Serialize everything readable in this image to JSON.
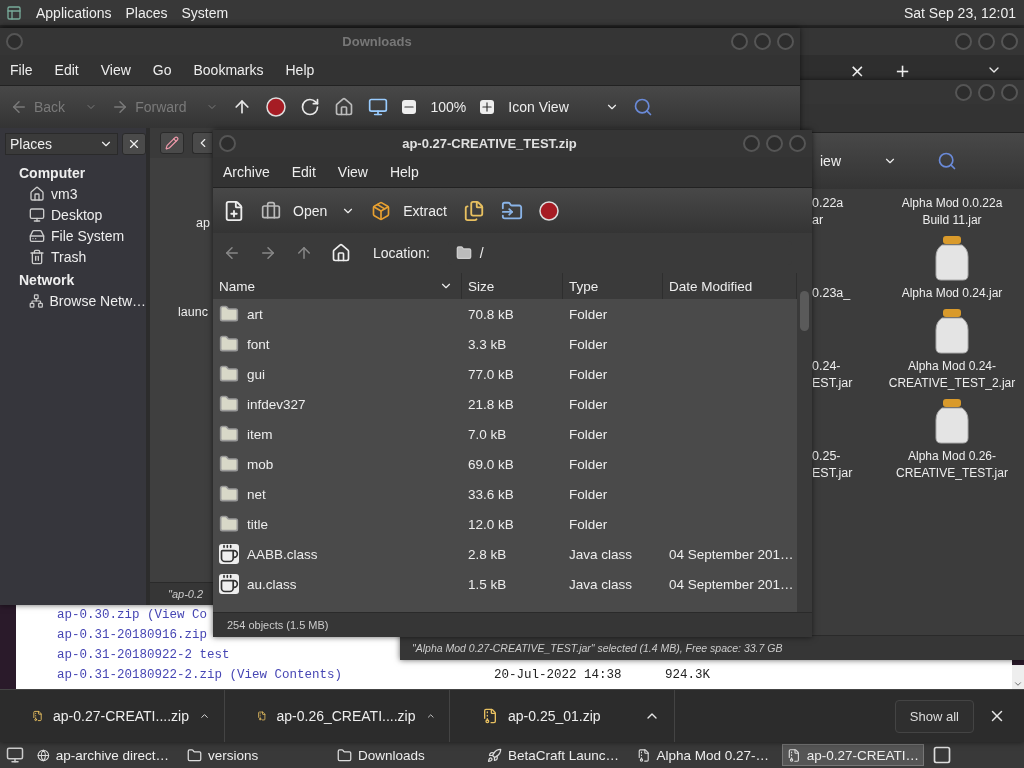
{
  "top_panel": {
    "menus": [
      "Applications",
      "Places",
      "System"
    ],
    "clock": "Sat Sep 23, 12:01"
  },
  "browser": {
    "tab_strip": {
      "close": "×",
      "new_tab": "+"
    },
    "listing": [
      {
        "name": "ap-0.30.zip",
        "detail": "(View Co"
      },
      {
        "name": "ap-0.31-20180916.zip"
      },
      {
        "name": "ap-0.31-20180922-2 test"
      },
      {
        "name": "ap-0.31-20180922-2.zip",
        "detail": "(View Contents)",
        "date": "20-Jul-2022 14:38",
        "size": "924.3K"
      }
    ],
    "downloads": [
      {
        "file": "ap-0.27-CREATI....zip"
      },
      {
        "file": "ap-0.26_CREATI....zip"
      },
      {
        "file": "ap-0.25_01.zip"
      }
    ],
    "show_all": "Show all"
  },
  "back_window": {
    "view_mode": "iew",
    "icons": [
      {
        "kind": "label",
        "label": "Alpha Mod 0.0.22a Build 11.jar",
        "cut_label": [
          "0.22a",
          "ar"
        ]
      },
      {
        "kind": "jar",
        "label": "Alpha Mod 0.24.jar",
        "cut_label": [
          "0.23a_"
        ]
      },
      {
        "kind": "jar",
        "label": "Alpha Mod 0.24-CREATIVE_TEST_2.jar",
        "cut_label": [
          "0.24-",
          "EST.jar"
        ]
      },
      {
        "kind": "jar",
        "label": "Alpha Mod 0.26-CREATIVE_TEST.jar",
        "cut_label": [
          "0.25-",
          "EST.jar"
        ]
      }
    ],
    "status": "\"Alpha Mod 0.27-CREATIVE_TEST.jar\" selected (1.4 MB), Free space: 33.7 GB"
  },
  "downloads_window": {
    "title": "Downloads",
    "menus": [
      "File",
      "Edit",
      "View",
      "Go",
      "Bookmarks",
      "Help"
    ],
    "toolbar": {
      "back": {
        "label": "Back",
        "disabled": true
      },
      "forward": {
        "label": "Forward",
        "disabled": true
      },
      "zoom": "100%",
      "view_mode": "Icon View"
    },
    "places": {
      "header": "Places",
      "sections": [
        {
          "heading": "Computer",
          "items": [
            {
              "kind": "home",
              "label": "vm3"
            },
            {
              "kind": "desktop",
              "label": "Desktop"
            },
            {
              "kind": "drive",
              "label": "File System"
            },
            {
              "kind": "trash",
              "label": "Trash"
            }
          ]
        },
        {
          "heading": "Network",
          "items": [
            {
              "kind": "network",
              "label": "Browse Netw…"
            }
          ]
        }
      ]
    },
    "cut_labels": [
      "ap",
      "launc"
    ],
    "status": "\"ap-0.2"
  },
  "archive_window": {
    "title": "ap-0.27-CREATIVE_TEST.zip",
    "menus": [
      "Archive",
      "Edit",
      "View",
      "Help"
    ],
    "toolbar": {
      "open": "Open",
      "extract": "Extract"
    },
    "location_label": "Location:",
    "location": "/",
    "columns": [
      "Name",
      "Size",
      "Type",
      "Date Modified"
    ],
    "rows": [
      {
        "kind": "folder",
        "name": "art",
        "size": "70.8 kB",
        "type": "Folder"
      },
      {
        "kind": "folder",
        "name": "font",
        "size": "3.3 kB",
        "type": "Folder"
      },
      {
        "kind": "folder",
        "name": "gui",
        "size": "77.0 kB",
        "type": "Folder"
      },
      {
        "kind": "folder",
        "name": "infdev327",
        "size": "21.8 kB",
        "type": "Folder"
      },
      {
        "kind": "folder",
        "name": "item",
        "size": "7.0 kB",
        "type": "Folder"
      },
      {
        "kind": "folder",
        "name": "mob",
        "size": "69.0 kB",
        "type": "Folder"
      },
      {
        "kind": "folder",
        "name": "net",
        "size": "33.6 kB",
        "type": "Folder"
      },
      {
        "kind": "folder",
        "name": "title",
        "size": "12.0 kB",
        "type": "Folder"
      },
      {
        "kind": "class",
        "name": "AABB.class",
        "size": "2.8 kB",
        "type": "Java class",
        "date": "04 September 201…"
      },
      {
        "kind": "class",
        "name": "au.class",
        "size": "1.5 kB",
        "type": "Java class",
        "date": "04 September 201…"
      }
    ],
    "status": "254 objects (1.5 MB)"
  },
  "taskbar": {
    "items": [
      {
        "kind": "browser",
        "label": "ap-archive direct…",
        "selected": false
      },
      {
        "kind": "folder",
        "label": "versions",
        "selected": false
      },
      {
        "kind": "folder",
        "label": "Downloads",
        "selected": false
      },
      {
        "kind": "launcher",
        "label": "BetaCraft Launc…",
        "selected": false
      },
      {
        "kind": "archive",
        "label": "Alpha Mod 0.27-…",
        "selected": false
      },
      {
        "kind": "archive",
        "label": "ap-0.27-CREATI…",
        "selected": true
      }
    ]
  }
}
